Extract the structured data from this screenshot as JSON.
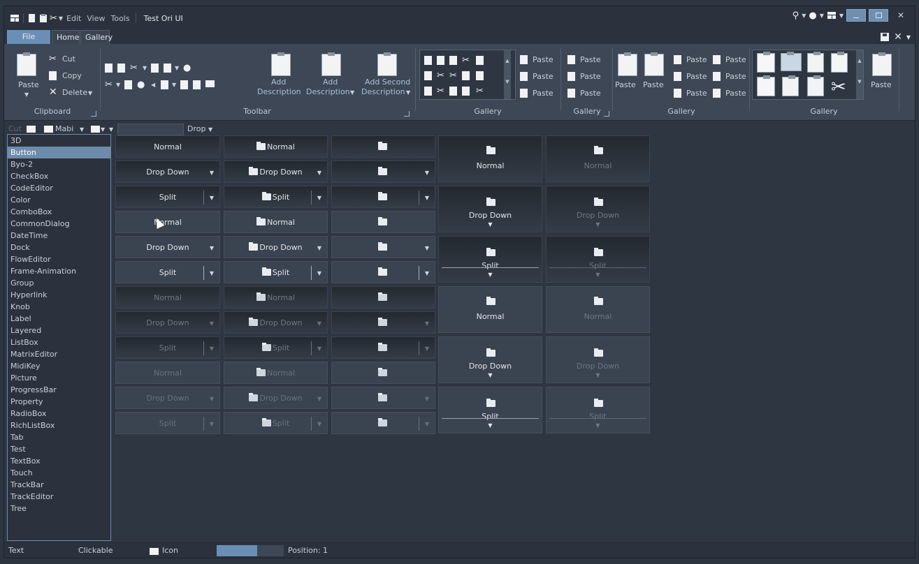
{
  "title_bar": {
    "menus": [
      "Edit",
      "View",
      "Tools"
    ],
    "title": "Test Ori UI",
    "minimize_icon": "minimize-icon",
    "maximize_icon": "maximize-icon",
    "close_label": "✕"
  },
  "tabs": {
    "file": "File",
    "home": "Home",
    "gallery": "Gallery"
  },
  "ribbon": {
    "clipboard": {
      "label": "Clipboard",
      "paste": "Paste",
      "cut": "Cut",
      "copy": "Copy",
      "delete": "Delete"
    },
    "toolbar": {
      "label": "Toolbar",
      "add_description_1": [
        "Add",
        "Description"
      ],
      "add_description_2": [
        "Add",
        "Description"
      ],
      "add_second_description": [
        "Add Second",
        "Description"
      ]
    },
    "gallery1": {
      "label": "Gallery",
      "paste_items": [
        "Paste",
        "Paste",
        "Paste"
      ]
    },
    "gallery2": {
      "label": "Gallery",
      "paste_items": [
        "Paste",
        "Paste",
        "Paste"
      ]
    },
    "gallery3": {
      "label": "Gallery",
      "big_paste": [
        "Paste",
        "Paste"
      ],
      "paste_items": [
        "Paste",
        "Paste",
        "Paste",
        "Paste",
        "Paste",
        "Paste"
      ]
    },
    "gallery4": {
      "label": "Gallery",
      "paste": "Paste"
    }
  },
  "subtoolbar": {
    "cut": "Cut",
    "mabi": "Mabi",
    "drop": "Drop"
  },
  "list": {
    "items": [
      "3D",
      "Button",
      "Byo-2",
      "CheckBox",
      "CodeEditor",
      "Color",
      "ComboBox",
      "CommonDialog",
      "DateTime",
      "Dock",
      "FlowEditor",
      "Frame-Animation",
      "Group",
      "Hyperlink",
      "Knob",
      "Label",
      "Layered",
      "ListBox",
      "MatrixEditor",
      "MidiKey",
      "Picture",
      "ProgressBar",
      "Property",
      "RadioBox",
      "RichListBox",
      "Tab",
      "Test",
      "TextBox",
      "Touch",
      "TrackBar",
      "TrackEditor",
      "Tree"
    ],
    "selected": "Button"
  },
  "buttons": {
    "normal": "Normal",
    "drop_down": "Drop Down",
    "split": "Split"
  },
  "status": {
    "text": "Text",
    "clickable": "Clickable",
    "icon": "Icon",
    "progress": 0.6,
    "position": "Position: 1"
  }
}
